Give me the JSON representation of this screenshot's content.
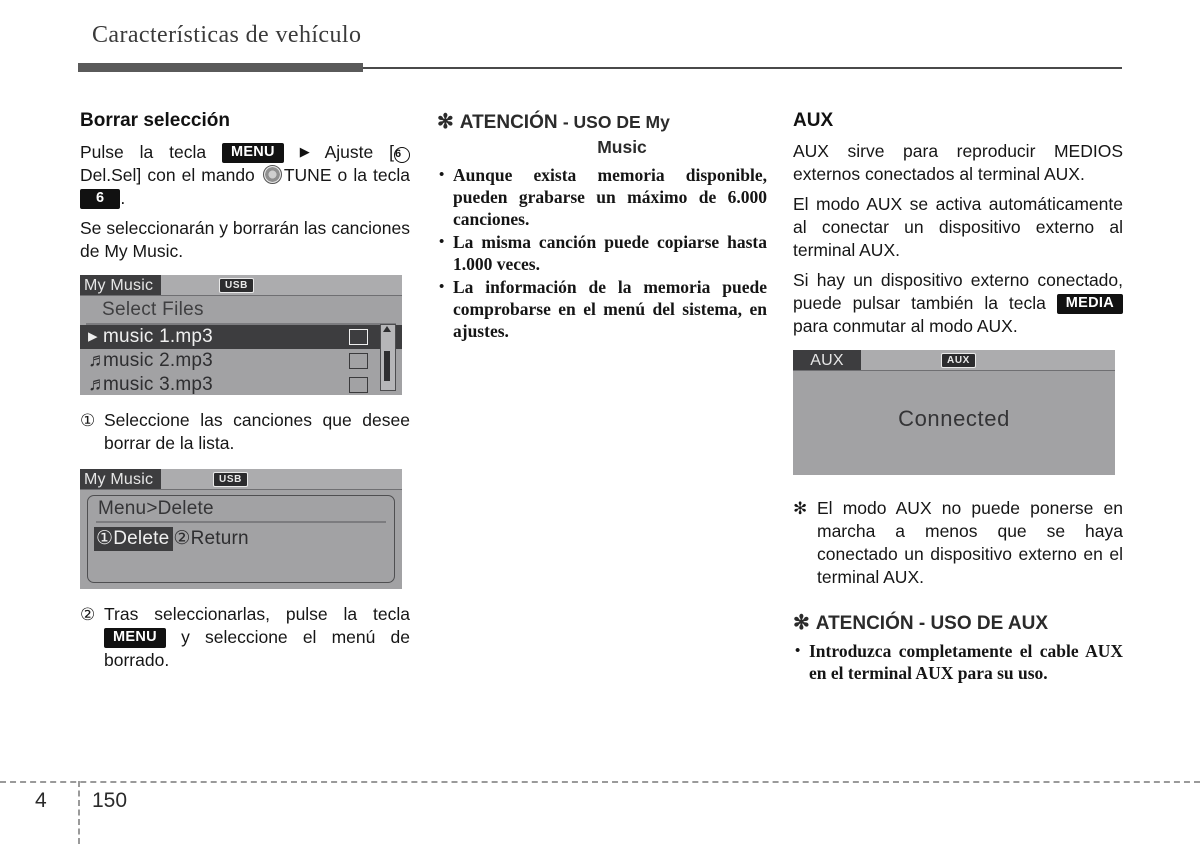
{
  "header": {
    "title": "Características de vehículo"
  },
  "footer": {
    "chapter": "4",
    "page": "150"
  },
  "left_column": {
    "heading": "Borrar selección",
    "para1_a": "Pulse la tecla",
    "key_menu": "MENU",
    "para1_b": "Ajuste [",
    "circ6": "6",
    "para1_c": "Del.Sel] con el mando",
    "para1_d": "TUNE o la tecla",
    "key_6": "6",
    "para1_e": ".",
    "para2": "Se seleccionarán y borrarán las canciones de My Music.",
    "screen1": {
      "tab": "My Music",
      "badge": "USB",
      "title": "Select Files",
      "rows": [
        {
          "glyph": "▸",
          "label": "music 1.mp3",
          "selected": true
        },
        {
          "glyph": "♬",
          "label": "music 2.mp3",
          "selected": false
        },
        {
          "glyph": "♬",
          "label": "music 3.mp3",
          "selected": false
        }
      ]
    },
    "step1_marker": "①",
    "step1_text": "Seleccione las canciones que desee borrar de la lista.",
    "screen2": {
      "tab": "My Music",
      "badge": "USB",
      "title": "Menu>Delete",
      "option1": "①Delete",
      "option2": "②Return"
    },
    "step2_marker": "②",
    "step2_a": "Tras seleccionarlas, pulse la tecla",
    "step2_key": "MENU",
    "step2_b": "y seleccione el menú de borrado."
  },
  "middle_column": {
    "caution_asterisk": "✻",
    "caution_title": "ATENCIÓN",
    "caution_subtitle": "- USO DE My",
    "caution_subtitle2": "Music",
    "bullets": [
      "Aunque exista memoria disponible, pueden grabarse un máximo de 6.000 canciones.",
      "La misma canción puede copiarse hasta 1.000 veces.",
      "La información de la memoria puede comprobarse en el menú del sistema, en ajustes."
    ],
    "bullet_dot": "•"
  },
  "right_column": {
    "heading": "AUX",
    "para1": "AUX sirve para reproducir MEDIOS externos conectados al terminal AUX.",
    "para2": "El modo AUX se activa automáticamente al conectar un dispositivo externo al terminal AUX.",
    "para3_a": "Si hay un dispositivo externo conectado, puede pulsar también la tecla",
    "key_media": "MEDIA",
    "para3_b": "para conmutar al modo AUX.",
    "screen3": {
      "tab": "AUX",
      "badge": "AUX",
      "status": "Connected"
    },
    "note_asterisk": "✻",
    "note_text": "El modo AUX no puede ponerse en marcha a menos que se haya conectado un dispositivo externo en el terminal AUX.",
    "caution_asterisk": "✻",
    "caution_title": "ATENCIÓN - USO DE AUX",
    "bullets": [
      "Introduzca completamente el cable AUX en el terminal AUX para su uso."
    ],
    "bullet_dot": "•"
  },
  "colors": {
    "header_bar": "#5a5a5a",
    "lcd_background": "#a2a2a4",
    "lcd_tab": "#3d3d3f",
    "key_pill": "#111111"
  }
}
